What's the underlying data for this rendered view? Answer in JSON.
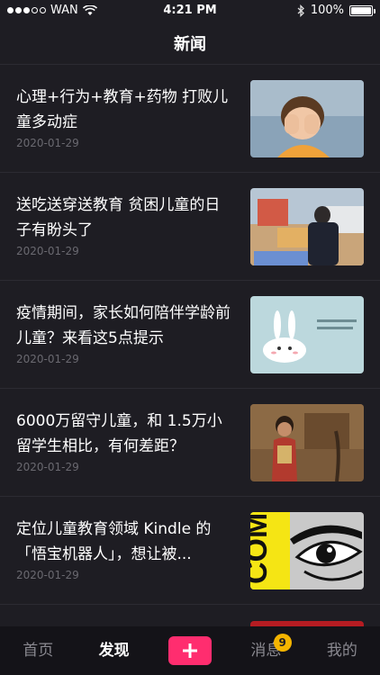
{
  "status_bar": {
    "carrier": "WAN",
    "time": "4:21 PM",
    "battery": "100%"
  },
  "nav": {
    "title": "新闻"
  },
  "news": [
    {
      "title": "心理+行为+教育+药物 打败儿童多动症",
      "date": "2020-01-29",
      "thumb": "child-covering-eyes-image"
    },
    {
      "title": "送吃送穿送教育 贫困儿童的日子有盼头了",
      "date": "2020-01-29",
      "thumb": "delivery-to-children-image"
    },
    {
      "title": "疫情期间，家长如何陪伴学龄前儿童？来看这5点提示",
      "date": "2020-01-29",
      "thumb": "rabbit-toy-image"
    },
    {
      "title": "6000万留守儿童，和 1.5万小留学生相比，有何差距？",
      "date": "2020-01-29",
      "thumb": "rural-child-image"
    },
    {
      "title": "定位儿童教育领域 Kindle 的「悟宝机器人」，想让被...",
      "date": "2020-01-29",
      "thumb": "com-eye-graphic-image"
    }
  ],
  "tab_bar": {
    "tabs": [
      "首页",
      "发现",
      "消息",
      "我的"
    ],
    "active": "发现",
    "badge_count": "9"
  },
  "colors": {
    "background": "#1e1d23",
    "accent": "#ff2d6f",
    "badge": "#f4b400",
    "date_text": "#6a6970"
  }
}
